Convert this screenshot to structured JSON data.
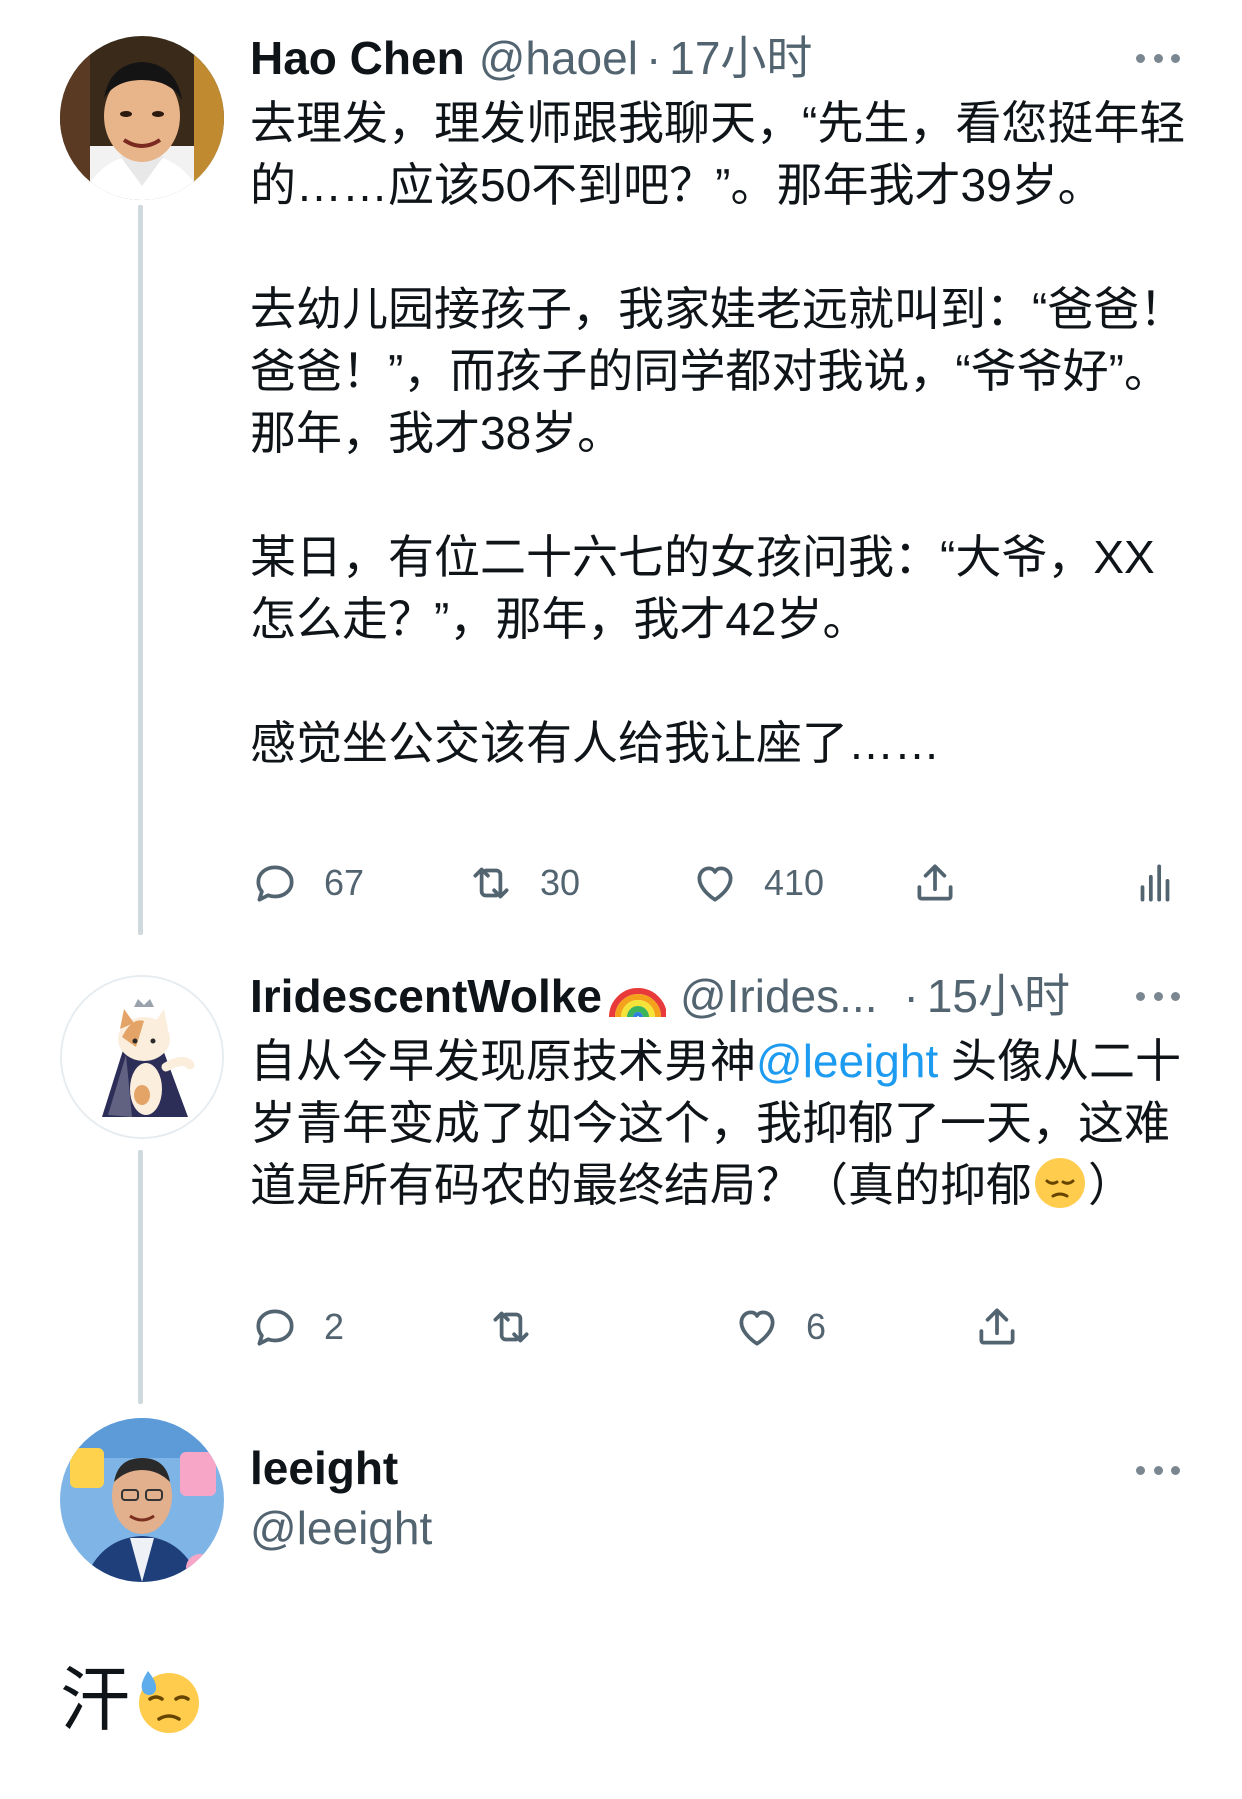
{
  "tweets": [
    {
      "name": "Hao Chen",
      "handle": "@haoel",
      "separator": "·",
      "time": "17小时",
      "paragraphs": [
        "去理发，理发师跟我聊天，“先生，看您挺年轻的……应该50不到吧？”。那年我才39岁。",
        "去幼儿园接孩子，我家娃老远就叫到：“爸爸！爸爸！”，而孩子的同学都对我说，“爷爷好”。那年，我才38岁。",
        "某日，有位二十六七的女孩问我：“大爷，XX怎么走？”，那年，我才42岁。",
        "感觉坐公交该有人给我让座了……"
      ],
      "replies": "67",
      "retweets": "30",
      "likes": "410"
    },
    {
      "name": "IridescentWolke",
      "name_emoji": "rainbow-emoji",
      "handle": "@Irides...",
      "separator": "·",
      "time": "15小时",
      "text_before": "自从今早发现原技术男神",
      "mention": "@leeight",
      "text_after": "头像从二十岁青年变成了如今这个，我抑郁了一天，这难道是所有码农的最终结局？（真的抑郁",
      "text_end": "）",
      "inline_emoji": "pensive-face-emoji",
      "replies": "2",
      "retweets": "",
      "likes": "6"
    }
  ],
  "main_tweet": {
    "name": "leeight",
    "handle": "@leeight",
    "text": "汗",
    "emoji": "downcast-face-with-sweat-emoji"
  },
  "icons": [
    "reply-icon",
    "retweet-icon",
    "like-icon",
    "share-icon",
    "analytics-icon",
    "more-icon"
  ],
  "colors": {
    "text": "#0f1419",
    "secondary": "#536471",
    "link": "#1d9bf0",
    "thread_line": "#cfd9de"
  }
}
